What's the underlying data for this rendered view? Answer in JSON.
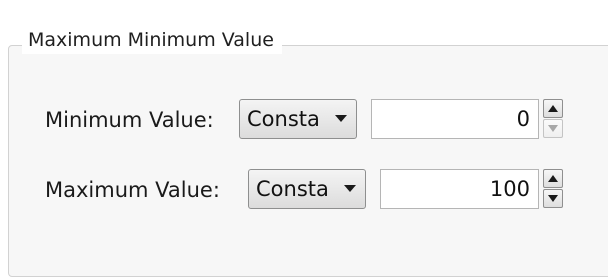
{
  "group": {
    "title": "Maximum Minimum Value"
  },
  "min_row": {
    "label": "Minimum Value:",
    "combo_value": "Consta",
    "spin_value": "0"
  },
  "max_row": {
    "label": "Maximum Value:",
    "combo_value": "Consta",
    "spin_value": "100"
  },
  "icons": {
    "combo_arrow": "chevron-down-icon",
    "spin_up": "triangle-up-icon",
    "spin_down": "triangle-down-icon"
  }
}
